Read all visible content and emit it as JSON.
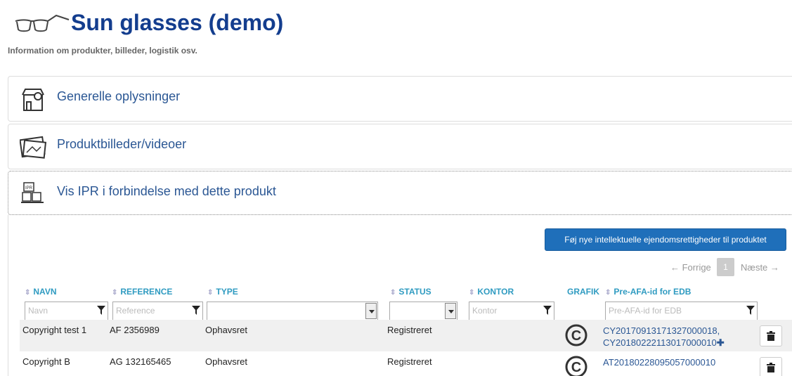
{
  "header": {
    "title": "Sun glasses (demo)",
    "subtitle": "Information om produkter, billeder, logistik osv."
  },
  "sections": [
    {
      "label": "Generelle oplysninger",
      "icon": "store-icon"
    },
    {
      "label": "Produktbilleder/videoer",
      "icon": "images-icon"
    },
    {
      "label": "Vis IPR i forbindelse med dette produkt",
      "icon": "ipr-boxes-icon"
    }
  ],
  "actions": {
    "add_label": "Føj nye intellektuelle ejendomsrettigheder til produktet"
  },
  "pager": {
    "prev": "← Forrige",
    "page": "1",
    "next": "Næste →"
  },
  "table": {
    "headers": [
      "NAVN",
      "REFERENCE",
      "TYPE",
      "STATUS",
      "KONTOR",
      "GRAFIK",
      "Pre-AFA-id for EDB"
    ],
    "filters": {
      "navn": "Navn",
      "reference": "Reference",
      "kontor": "Kontor",
      "preafa": "Pre-AFA-id for EDB"
    },
    "rows": [
      {
        "navn": "Copyright test 1",
        "reference": "AF 2356989",
        "type": "Ophavsret",
        "status": "Registreret",
        "kontor": "",
        "grafik": "copyright-icon",
        "preafa": "CY20170913171327000018, CY20180222113017000010"
      },
      {
        "navn": "Copyright B",
        "reference": "AG 132165465",
        "type": "Ophavsret",
        "status": "Registreret",
        "kontor": "",
        "grafik": "copyright-icon",
        "preafa": "AT20180228095057000010"
      }
    ]
  },
  "colors": {
    "title": "#133d8e",
    "link": "#2b5794",
    "header": "#2f9bc1",
    "button": "#1f6fba"
  }
}
